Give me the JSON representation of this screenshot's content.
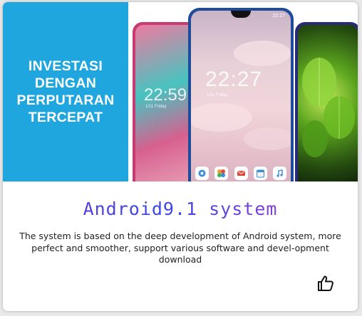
{
  "promo": {
    "lines": [
      "INVESTASI",
      "DENGAN",
      "PERPUTARAN",
      "TERCEPAT"
    ],
    "background": "#1fa6de"
  },
  "phones": {
    "center": {
      "status": "22:27",
      "clock": "22:27",
      "date": "1/11 Friday"
    },
    "left": {
      "clock": "22:59",
      "date": "1/11 Friday"
    }
  },
  "dock_icons": [
    "settings-icon",
    "gallery-icon",
    "mail-icon",
    "calendar-icon",
    "music-icon"
  ],
  "product": {
    "title": "Android9.1 system",
    "description": "The system is based on the deep development of Android system, more perfect and smoother, support various software and devel-opment download"
  },
  "actions": {
    "like_icon": "thumbs-up-icon"
  },
  "colors": {
    "title_gradient_start": "#6a3ad8",
    "title_gradient_end": "#b03ad0"
  }
}
